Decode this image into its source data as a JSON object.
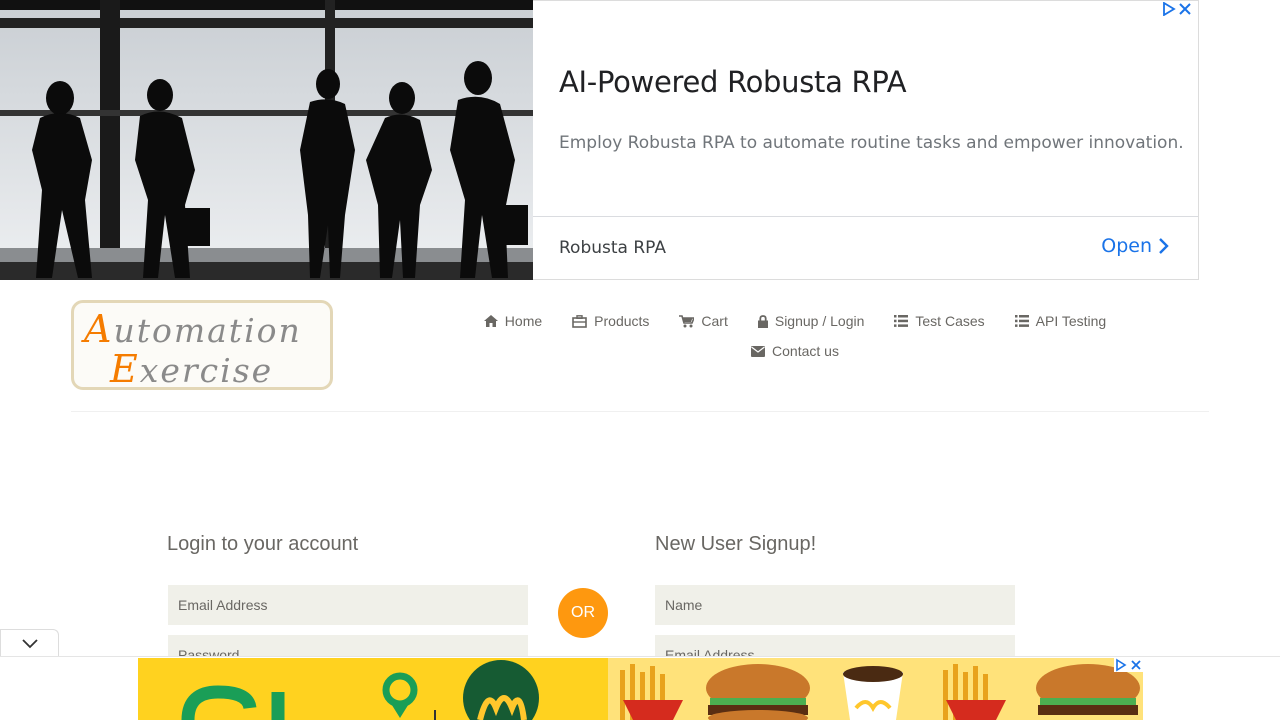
{
  "ad_top": {
    "headline": "AI-Powered Robusta RPA",
    "description": "Employ Robusta RPA to automate routine tasks and empower innovation.",
    "advertiser": "Robusta RPA",
    "cta": "Open"
  },
  "logo": {
    "line1_cap": "A",
    "line1_rest": "utomation",
    "line2_cap": "E",
    "line2_rest": "xercise"
  },
  "nav": {
    "items": [
      {
        "label": "Home",
        "icon": "home-icon"
      },
      {
        "label": "Products",
        "icon": "products-icon"
      },
      {
        "label": "Cart",
        "icon": "cart-icon"
      },
      {
        "label": "Signup / Login",
        "icon": "lock-icon"
      },
      {
        "label": "Test Cases",
        "icon": "list-icon"
      },
      {
        "label": "API Testing",
        "icon": "list-icon"
      },
      {
        "label": "Contact us",
        "icon": "envelope-icon"
      }
    ]
  },
  "login": {
    "title": "Login to your account",
    "email_placeholder": "Email Address",
    "password_placeholder": "Password"
  },
  "or_label": "OR",
  "signup": {
    "title": "New User Signup!",
    "name_placeholder": "Name",
    "email_placeholder": "Email Address"
  },
  "colors": {
    "accent": "#FE980F",
    "field_bg": "#F0F0E9",
    "text": "#696763",
    "ad_link": "#1A73E8"
  }
}
